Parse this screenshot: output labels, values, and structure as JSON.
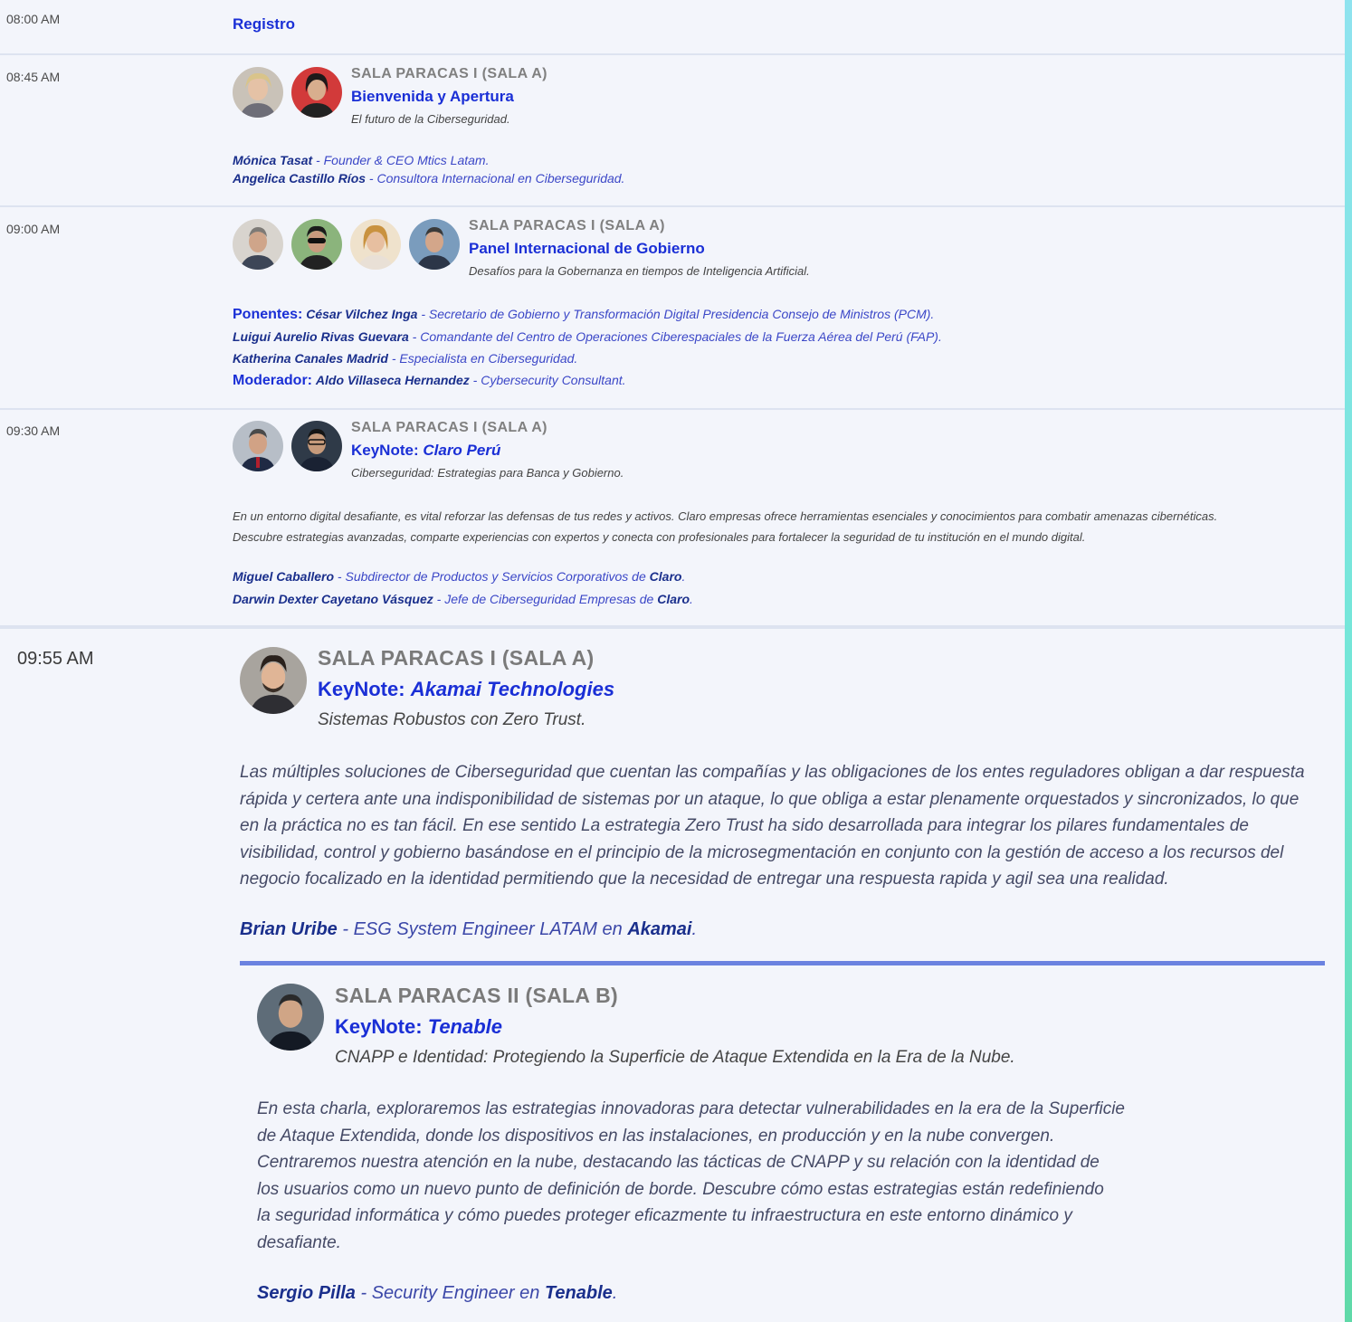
{
  "colors": {
    "accent": "#1a2fd6",
    "room_gray": "#808080",
    "rule": "#6b82e0"
  },
  "slots": [
    {
      "time": "08:00 AM",
      "title": "Registro"
    },
    {
      "time": "08:45 AM",
      "room": "SALA PARACAS I (SALA A)",
      "title": "Bienvenida y Apertura",
      "subtitle": "El futuro de la Ciberseguridad.",
      "speakers": [
        {
          "name": "Mónica Tasat",
          "role": "Founder & CEO Mtics Latam."
        },
        {
          "name": "Angelica Castillo Ríos",
          "role": "Consultora Internacional en Ciberseguridad."
        }
      ]
    },
    {
      "time": "09:00 AM",
      "room": "SALA PARACAS I (SALA A)",
      "title": "Panel Internacional de Gobierno",
      "subtitle": "Desafíos para la Gobernanza en tiempos de Inteligencia Artificial.",
      "ponentes_label": "Ponentes:",
      "moderador_label": "Moderador:",
      "speakers": [
        {
          "name": "César Vilchez Inga",
          "role": "Secretario de Gobierno y Transformación Digital Presidencia Consejo de Ministros (PCM)."
        },
        {
          "name": "Luigui Aurelio Rivas Guevara",
          "role": "Comandante del Centro de Operaciones Ciberespaciales de la Fuerza Aérea del Perú (FAP)."
        },
        {
          "name": "Katherina Canales Madrid",
          "role": "Especialista en Ciberseguridad."
        },
        {
          "name": "Aldo Villaseca Hernandez",
          "role": "Cybersecurity Consultant."
        }
      ]
    },
    {
      "time": "09:30 AM",
      "room": "SALA PARACAS I (SALA A)",
      "title_prefix": "KeyNote:",
      "title_company": "Claro Perú",
      "subtitle": "Ciberseguridad: Estrategias para Banca y Gobierno.",
      "description": [
        "En un entorno digital desafiante, es vital reforzar las defensas de tus redes y activos. Claro empresas ofrece herramientas esenciales y conocimientos para combatir amenazas cibernéticas.",
        "Descubre estrategias avanzadas, comparte experiencias con expertos y conecta con profesionales para fortalecer la seguridad de tu institución en el mundo digital."
      ],
      "speakers": [
        {
          "name": "Miguel Caballero",
          "role": "Subdirector de Productos y Servicios Corporativos de",
          "org": "Claro",
          "end": "."
        },
        {
          "name": "Darwin Dexter Cayetano Vásquez",
          "role": "Jefe de Ciberseguridad Empresas de",
          "org": "Claro",
          "end": "."
        }
      ]
    },
    {
      "time": "09:55 AM",
      "room": "SALA PARACAS I (SALA A)",
      "title_prefix": "KeyNote:",
      "title_company": "Akamai Technologies",
      "subtitle": "Sistemas Robustos con Zero Trust.",
      "description": [
        "Las múltiples soluciones de Ciberseguridad que cuentan las compañías y las obligaciones de los entes reguladores obligan a dar respuesta",
        "rápida y certera ante una indisponibilidad de sistemas por un ataque, lo que obliga a estar plenamente orquestados y sincronizados, lo que",
        "en la práctica no es tan fácil. En ese sentido La estrategia Zero Trust ha sido desarrollada para integrar los pilares fundamentales de",
        "visibilidad, control y gobierno basándose en el principio de la microsegmentación en conjunto con la gestión de acceso a los recursos del",
        "negocio focalizado en la identidad permitiendo que la necesidad de entregar una respuesta rapida y agil sea una realidad."
      ],
      "speakers": [
        {
          "name": "Brian Uribe",
          "role": "ESG System Engineer LATAM en",
          "org": "Akamai",
          "end": "."
        }
      ],
      "parallel": {
        "room": "SALA PARACAS II (SALA B)",
        "title_prefix": "KeyNote:",
        "title_company": "Tenable",
        "subtitle": "CNAPP e Identidad: Protegiendo la Superficie de Ataque Extendida en la Era de la Nube.",
        "description": [
          "En esta charla, exploraremos las estrategias innovadoras para detectar vulnerabilidades en la era de la Superficie",
          "de Ataque Extendida, donde los dispositivos en las instalaciones, en producción y en la nube convergen.",
          "Centraremos nuestra atención en la nube, destacando las tácticas de CNAPP y su relación con la identidad de",
          "los usuarios como un nuevo punto de definición de borde. Descubre cómo estas estrategias están redefiniendo",
          "la seguridad informática y cómo puedes proteger eficazmente tu infraestructura en este entorno dinámico y",
          "desafiante."
        ],
        "speakers": [
          {
            "name": "Sergio Pilla",
            "role": "Security Engineer en",
            "org": "Tenable",
            "end": "."
          }
        ]
      }
    }
  ]
}
